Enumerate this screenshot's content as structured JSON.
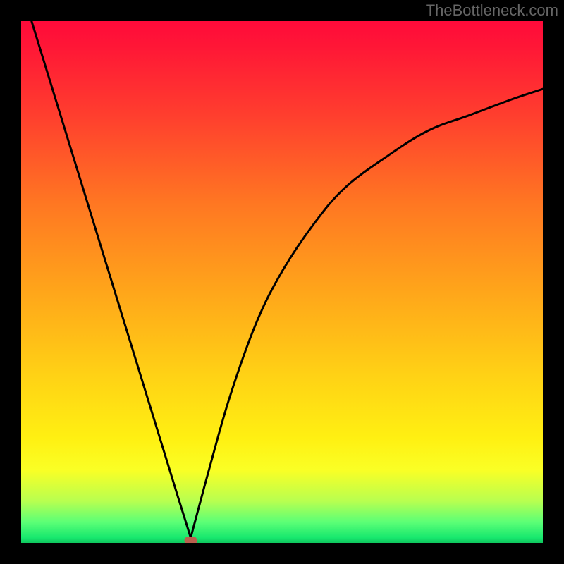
{
  "watermark": "TheBottleneck.com",
  "colors": {
    "frame": "#000000",
    "curve": "#000000",
    "dot": "#b9604e",
    "gradient_top": "#ff0a3a",
    "gradient_bottom": "#10c75e"
  },
  "chart_data": {
    "type": "line",
    "title": "",
    "xlabel": "",
    "ylabel": "",
    "xlim": [
      0,
      100
    ],
    "ylim": [
      0,
      100
    ],
    "annotations": [
      {
        "text": "TheBottleneck.com",
        "pos": "top-right"
      }
    ],
    "series": [
      {
        "name": "left-branch",
        "x": [
          2,
          6,
          10,
          14,
          18,
          22,
          26,
          30,
          32.5
        ],
        "y": [
          100,
          87,
          74,
          61,
          48,
          35,
          22,
          9,
          1
        ]
      },
      {
        "name": "right-branch",
        "x": [
          32.5,
          36,
          40,
          45,
          50,
          56,
          62,
          70,
          78,
          86,
          94,
          100
        ],
        "y": [
          1,
          14,
          28,
          42,
          52,
          61,
          68,
          74,
          79,
          82,
          85,
          87
        ]
      }
    ],
    "marker": {
      "x": 32.5,
      "y": 0.5,
      "shape": "rounded-rect",
      "color": "#b9604e"
    }
  }
}
